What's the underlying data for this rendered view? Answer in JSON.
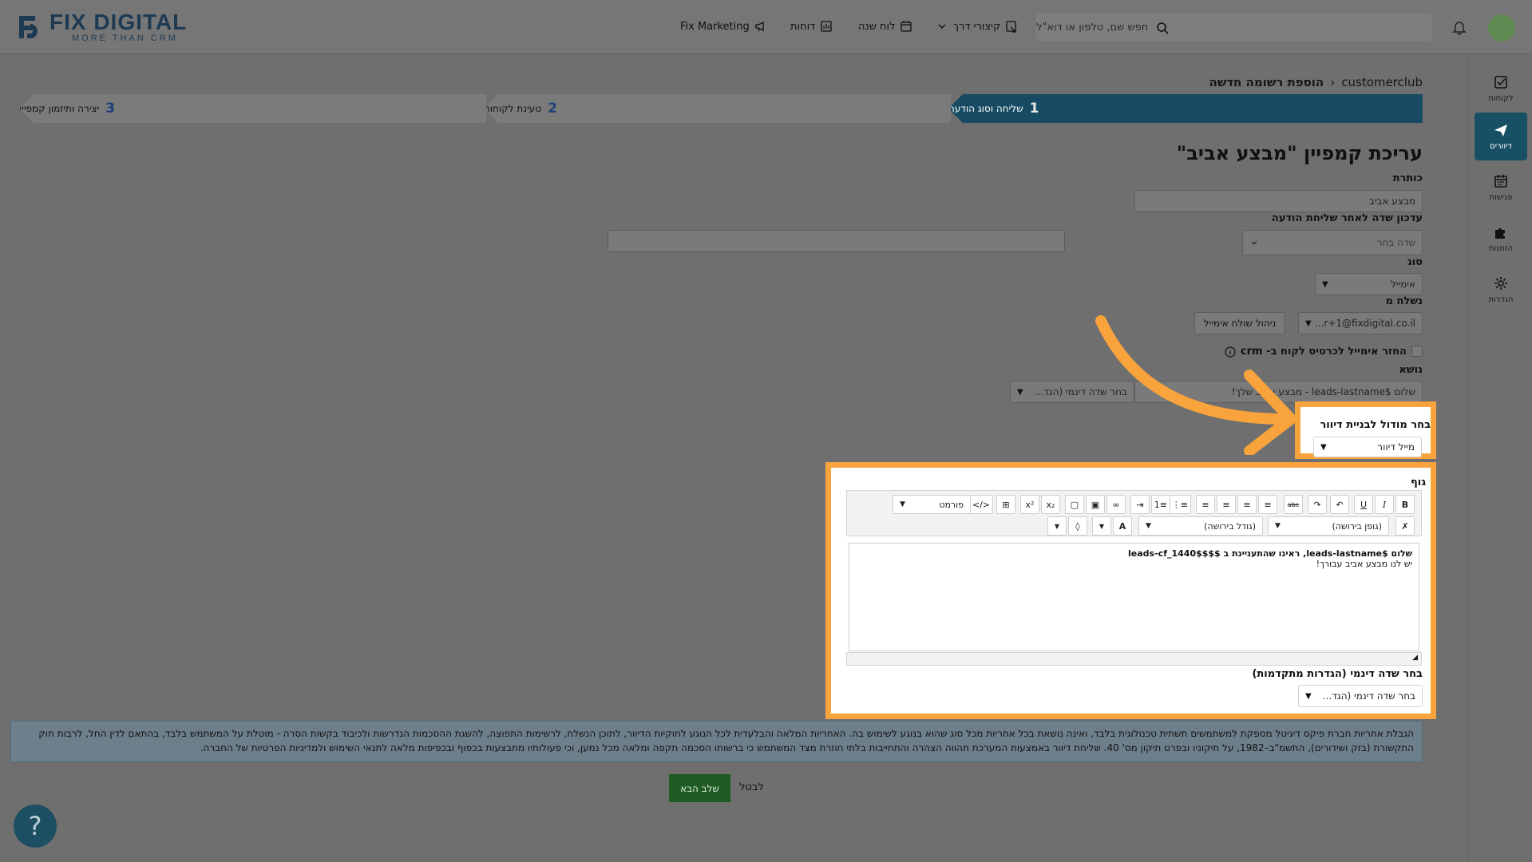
{
  "header": {
    "logo_text": "FIX DIGITAL",
    "logo_tagline": "MORE THAN CRM",
    "nav": [
      {
        "label": "Fix Marketing",
        "icon": "megaphone-icon"
      },
      {
        "label": "דוחות",
        "icon": "bar-chart-icon"
      },
      {
        "label": "לוח שנה",
        "icon": "calendar-icon"
      },
      {
        "label": "קיצורי דרך",
        "icon": "shortcut-icon"
      }
    ],
    "search_placeholder": "חפש שם, טלפון או דוא\"ל"
  },
  "rail": [
    {
      "label": "לקוחות",
      "icon": "checkbox-icon",
      "active": false
    },
    {
      "label": "דיוורים",
      "icon": "send-icon",
      "active": true
    },
    {
      "label": "פגישות",
      "icon": "calendar-icon",
      "active": false
    },
    {
      "label": "הזמנות",
      "icon": "puzzle-icon",
      "active": false
    },
    {
      "label": "הגדרות",
      "icon": "gear-icon",
      "active": false
    }
  ],
  "breadcrumb": {
    "root": "customerclub",
    "current": "הוספת רשומה חדשה"
  },
  "steps": [
    {
      "num": "1",
      "label": "שליחה וסוג הודעה"
    },
    {
      "num": "2",
      "label": "טעינת לקוחות"
    },
    {
      "num": "3",
      "label": "יצירה ותיזמון קמפיין"
    }
  ],
  "form": {
    "page_title": "עריכת קמפיין \"מבצע אביב\"",
    "title_label": "כותרת",
    "title_value": "מבצע אביב",
    "update_label": "עדכון שדה לאחר שליחת הודעה",
    "update_placeholder": "שדה בחר",
    "type_label": "סוג",
    "type_value": "אימייל",
    "sender_label": "נשלח מ",
    "sender_value": "r+1@fixdigital.co.il...",
    "sender_manage": "ניהול שולח אימייל",
    "crm_checkbox_label": "החזר אימייל לכרטיס לקוח ב- crm",
    "subject_label": "נושא",
    "subject_value": "שלום $leads-lastname - מבצע אביב שלך!",
    "dynamic_field_label": "בחר שדה דינמי (הגד...",
    "module_label": "בחר מודול לבניית דיוור",
    "module_value": "מייל דיוור",
    "body_label": "גוף",
    "format_label": "פורמט",
    "font_label": "(גופן בירושה)",
    "size_label": "(גודל בירושה)",
    "body_line1": "שלום $leads-lastname, ראינו שהתעניינת ב $$leads-cf_1440$$",
    "body_line2": "יש לנו מבצע אביב עבורך!",
    "advanced_dynamic_label": "בחר שדה דינמי (הגדרות מתקדמות)",
    "advanced_dynamic_value": "בחר שדה דינמי (הגד..."
  },
  "disclaimer": "הגבלת אחריות חברת פיקס דיגיטל מספקת למשתמשים תשתית טכנולוגית בלבד, ואינה נושאת בכל אחריות מכל סוג שהוא בנוגע לשימוש בה. האחריות המלאה והבלעדית לכל הנוגע לחוקיות הדיוור, לתוכן הנשלח, לרשימות התפוצה, להשגת ההסכמות הנדרשות ולכיבוד בקשות הסרה - מוטלת על המשתמש בלבד, בהתאם לדין החל, לרבות חוק התקשורת (בזק ושידורים), התשמ\"ב–1982, על תיקוניו ובפרט תיקון מס' 40. שליחת דיוור באמצעות המערכת תהווה הצהרה והתחייבות בלתי חוזרת מצד המשתמש כי ברשותו הסכמה תקפה ומלאה מכל נמען, וכי פעולותיו מתבצעות בכפוף ובכפיפות מלאה לתנאי השימוש ולמדיניות הפרטיות של החברה.",
  "footer": {
    "next": "שלב הבא",
    "cancel": "לבטל",
    "help": "?"
  },
  "colors": {
    "highlight": "#f8a33c",
    "accent": "#174b63",
    "next_button": "#1f5b22"
  }
}
